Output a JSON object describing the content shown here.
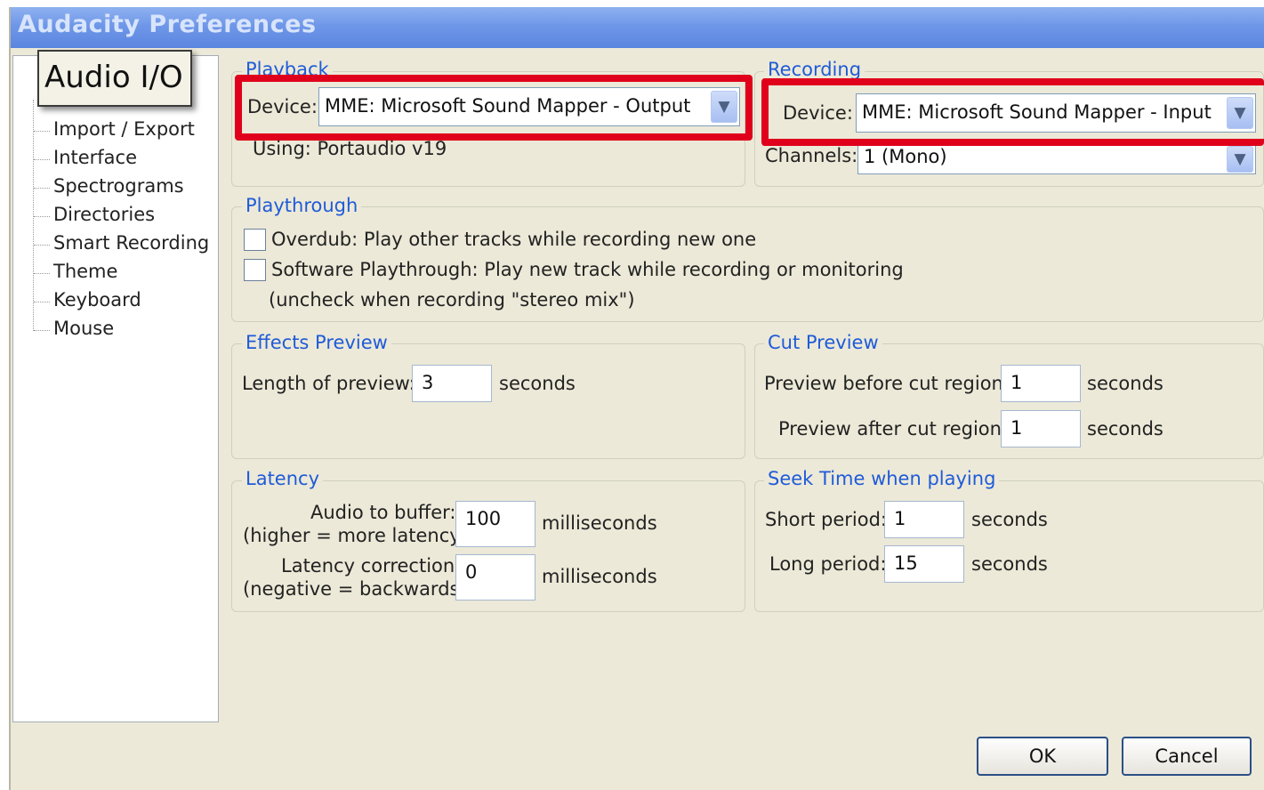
{
  "window": {
    "title": "Audacity Preferences"
  },
  "sidebar": {
    "selected": "Audio I/O",
    "items": [
      {
        "label": "Import / Export"
      },
      {
        "label": "Interface"
      },
      {
        "label": "Spectrograms"
      },
      {
        "label": "Directories"
      },
      {
        "label": "Smart Recording"
      },
      {
        "label": "Theme"
      },
      {
        "label": "Keyboard"
      },
      {
        "label": "Mouse"
      }
    ]
  },
  "playback": {
    "title": "Playback",
    "device_label": "Device:",
    "device_value": "MME: Microsoft Sound Mapper - Output",
    "using_label": "Using: Portaudio v19"
  },
  "recording": {
    "title": "Recording",
    "device_label": "Device:",
    "device_value": "MME: Microsoft Sound Mapper - Input",
    "channels_label": "Channels:",
    "channels_value": "1 (Mono)"
  },
  "playthrough": {
    "title": "Playthrough",
    "overdub": {
      "label": "Overdub: Play other tracks while recording new one",
      "checked": false
    },
    "software": {
      "label": "Software Playthrough: Play new track while recording or monitoring",
      "checked": false
    },
    "note": "(uncheck when recording \"stereo mix\")"
  },
  "effects_preview": {
    "title": "Effects Preview",
    "length_label": "Length of preview:",
    "length_value": "3",
    "unit": "seconds"
  },
  "cut_preview": {
    "title": "Cut Preview",
    "before_label": "Preview before cut region:",
    "before_value": "1",
    "after_label": "Preview after cut region:",
    "after_value": "1",
    "unit": "seconds"
  },
  "latency": {
    "title": "Latency",
    "buffer_label_1": "Audio to buffer:",
    "buffer_label_2": "(higher = more latency)",
    "buffer_value": "100",
    "correction_label_1": "Latency correction:",
    "correction_label_2": "(negative = backwards)",
    "correction_value": "0",
    "unit": "milliseconds"
  },
  "seek_time": {
    "title": "Seek Time when playing",
    "short_label": "Short period:",
    "short_value": "1",
    "long_label": "Long period:",
    "long_value": "15",
    "unit": "seconds"
  },
  "buttons": {
    "ok": "OK",
    "cancel": "Cancel"
  },
  "colors": {
    "highlight": "#e0001b",
    "group_title": "#1f5bd8",
    "titlebar": "#6f97e8"
  },
  "icons": {
    "dropdown": "chevron-down-icon"
  }
}
